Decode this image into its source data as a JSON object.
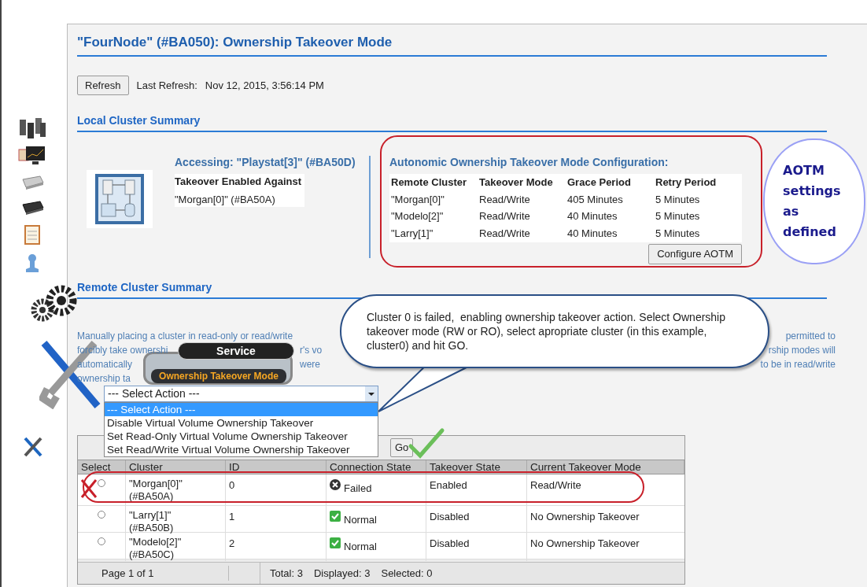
{
  "title": "\"FourNode\" (#BA050): Ownership Takeover Mode",
  "refresh": {
    "button": "Refresh",
    "label": "Last Refresh:",
    "value": "Nov 12, 2015, 3:56:14 PM"
  },
  "local_summary": {
    "heading": "Local Cluster Summary",
    "accessing": "Accessing: \"Playstat[3]\" (#BA50D)",
    "enabled_against_heading": "Takeover Enabled Against",
    "enabled_against": [
      "\"Morgan[0]\" (#BA50A)"
    ],
    "aotm": {
      "heading": "Autonomic Ownership Takeover Mode Configuration:",
      "columns": [
        "Remote Cluster",
        "Takeover Mode",
        "Grace Period",
        "Retry Period"
      ],
      "rows": [
        [
          "\"Morgan[0]\"",
          "Read/Write",
          "405 Minutes",
          "5 Minutes"
        ],
        [
          "\"Modelo[2]\"",
          "Read/Write",
          "40 Minutes",
          "5 Minutes"
        ],
        [
          "\"Larry[1]\"",
          "Read/Write",
          "40 Minutes",
          "5 Minutes"
        ]
      ],
      "button": "Configure AOTM"
    }
  },
  "aotm_note": "AOTM settings as defined",
  "remote_summary": {
    "heading": "Remote Cluster Summary",
    "description_lines": [
      {
        "left": "Manually placing a cluster in read-only or read/write",
        "right": "permitted to"
      },
      {
        "left": "forcibly take ownershi",
        "middle": "r's vo",
        "right": "rship modes will"
      },
      {
        "left": "automatically",
        "middle": "were",
        "right": "to be in read/write"
      },
      {
        "left": "ownership ta"
      }
    ]
  },
  "service_popup": {
    "title": "Service",
    "item": "Ownership Takeover Mode"
  },
  "action_select": {
    "value": "--- Select Action ---",
    "options": [
      {
        "label": "--- Select Action ---",
        "selected": true
      },
      {
        "label": "Disable Virtual Volume Ownership Takeover",
        "selected": false
      },
      {
        "label": "Set Read-Only Virtual Volume Ownership Takeover",
        "selected": false
      },
      {
        "label": "Set Read/Write Virtual Volume Ownership Takeover",
        "selected": false
      }
    ]
  },
  "go_button": "Go",
  "callout": "Cluster 0 is failed,  enabling ownership takeover action. Select Ownership takeover mode (RW or RO), select apropriate cluster (in this example, cluster0) and hit GO.",
  "clusters_table": {
    "columns": [
      "Select",
      "Cluster",
      "ID",
      "Connection State",
      "Takeover State",
      "Current Takeover Mode"
    ],
    "rows": [
      {
        "selected": false,
        "highlighted": true,
        "cluster": "\"Morgan[0]\" (#BA50A)",
        "id": "0",
        "kind": "failed",
        "connection_state": "Failed",
        "takeover_state": "Enabled",
        "takeover_mode": "Read/Write"
      },
      {
        "selected": false,
        "highlighted": false,
        "cluster": "\"Larry[1]\" (#BA50B)",
        "id": "1",
        "kind": "normal",
        "connection_state": "Normal",
        "takeover_state": "Disabled",
        "takeover_mode": "No Ownership Takeover"
      },
      {
        "selected": false,
        "highlighted": false,
        "cluster": "\"Modelo[2]\" (#BA50C)",
        "id": "2",
        "kind": "normal",
        "connection_state": "Normal",
        "takeover_state": "Disabled",
        "takeover_mode": "No Ownership Takeover"
      }
    ],
    "footer": {
      "page": "Page 1 of 1",
      "total": "Total: 3",
      "displayed": "Displayed: 3",
      "selected": "Selected: 0"
    }
  }
}
